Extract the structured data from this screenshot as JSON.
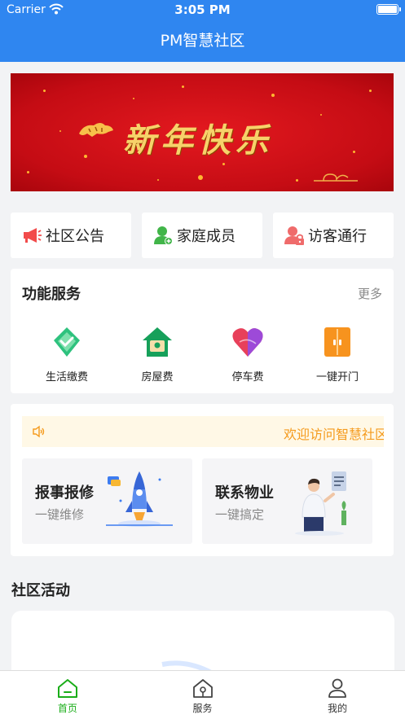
{
  "status_bar": {
    "carrier": "Carrier",
    "time": "3:05 PM"
  },
  "nav": {
    "title": "PM智慧社区"
  },
  "banner": {
    "greeting": "新年快乐"
  },
  "quick_links": [
    {
      "label": "社区公告",
      "icon": "megaphone-icon"
    },
    {
      "label": "家庭成员",
      "icon": "family-member-icon"
    },
    {
      "label": "访客通行",
      "icon": "visitor-lock-icon"
    }
  ],
  "services": {
    "title": "功能服务",
    "more": "更多",
    "items": [
      {
        "label": "生活缴费",
        "icon": "life-payment-icon",
        "color": "#2ec27e"
      },
      {
        "label": "房屋费",
        "icon": "house-fee-icon",
        "color": "#16a05a"
      },
      {
        "label": "停车费",
        "icon": "parking-fee-icon",
        "color": "#e8405a"
      },
      {
        "label": "一键开门",
        "icon": "door-open-icon",
        "color": "#f7931e"
      }
    ]
  },
  "notice": {
    "text": "欢迎访问智慧社区"
  },
  "tiles": [
    {
      "title": "报事报修",
      "subtitle": "一键维修"
    },
    {
      "title": "联系物业",
      "subtitle": "一键搞定"
    }
  ],
  "activity": {
    "title": "社区活动"
  },
  "tabbar": [
    {
      "label": "首页",
      "icon": "home-icon"
    },
    {
      "label": "服务",
      "icon": "service-house-icon"
    },
    {
      "label": "我的",
      "icon": "profile-icon"
    }
  ],
  "colors": {
    "primary": "#2f86f0",
    "active_tab": "#1aad19",
    "notice_text": "#f59a1c"
  }
}
